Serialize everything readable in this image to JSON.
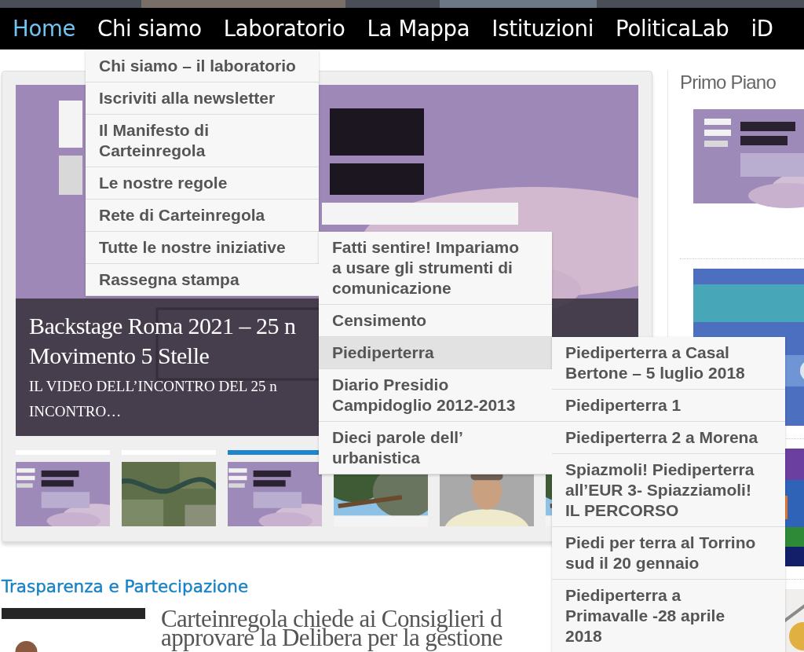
{
  "nav": [
    {
      "label": "Home",
      "selected": true
    },
    {
      "label": "Chi siamo",
      "selected": false,
      "children": [
        {
          "label": "Chi siamo – il laboratorio",
          "selected": false
        },
        {
          "label": "Iscriviti alla newsletter",
          "selected": false
        },
        {
          "label": "Il Manifesto di Carteinregola",
          "selected": false
        },
        {
          "label": "Le nostre regole",
          "selected": false
        },
        {
          "label": "Rete di Carteinregola",
          "selected": false
        },
        {
          "label": "Tutte le nostre iniziative",
          "selected": false,
          "children": [
            {
              "label": "Fatti sentire! Impariamo a usare gli strumenti di comunicazione",
              "selected": false
            },
            {
              "label": "Censimento",
              "selected": false
            },
            {
              "label": "Piediperterra",
              "selected": true,
              "children": [
                {
                  "label": "Piediperterra a Casal Bertone – 5 luglio 2018",
                  "selected": false
                },
                {
                  "label": "Piediperterra 1",
                  "selected": false
                },
                {
                  "label": "Piediperterra 2 a Morena",
                  "selected": false
                },
                {
                  "label": "Spiazmoli! Piediperterra all’EUR 3- Spiazziamoli! IL PERCORSO",
                  "selected": false
                },
                {
                  "label": "Piedi per terra al Torrino sud il 20 gennaio",
                  "selected": false
                },
                {
                  "label": "Piediperterra a Primavalle -28 aprile 2018",
                  "selected": false
                }
              ]
            },
            {
              "label": "Diario Presidio Campidoglio 2012-2013",
              "selected": false
            },
            {
              "label": "Dieci parole dell’ urbanistica",
              "selected": false
            }
          ]
        },
        {
          "label": "Rassegna stampa",
          "selected": false
        }
      ]
    },
    {
      "label": "Laboratorio",
      "selected": false
    },
    {
      "label": "La Mappa",
      "selected": false
    },
    {
      "label": "Istituzioni",
      "selected": false
    },
    {
      "label": "PoliticaLab",
      "selected": false
    },
    {
      "label": "iD",
      "selected": false
    }
  ],
  "slider": {
    "caption_title": [
      "Backstage Roma 2021 – 25 n",
      "Movimento 5 Stelle"
    ],
    "caption_text": [
      "IL VIDEO DELL’INCONTRO DEL 25 n",
      "INCONTRO…"
    ],
    "thumbnails": [
      {
        "selected": false
      },
      {
        "selected": false
      },
      {
        "selected": true
      },
      {
        "kind": "picture"
      },
      {
        "kind": "picture"
      },
      {
        "kind": "picture"
      }
    ]
  },
  "section": {
    "title": "Trasparenza e Partecipazione",
    "article_title": [
      "Carteinregola chiede ai Consiglieri d",
      "approvare la Delibera per la gestione"
    ]
  },
  "sidebar": {
    "title": "Primo Piano"
  }
}
